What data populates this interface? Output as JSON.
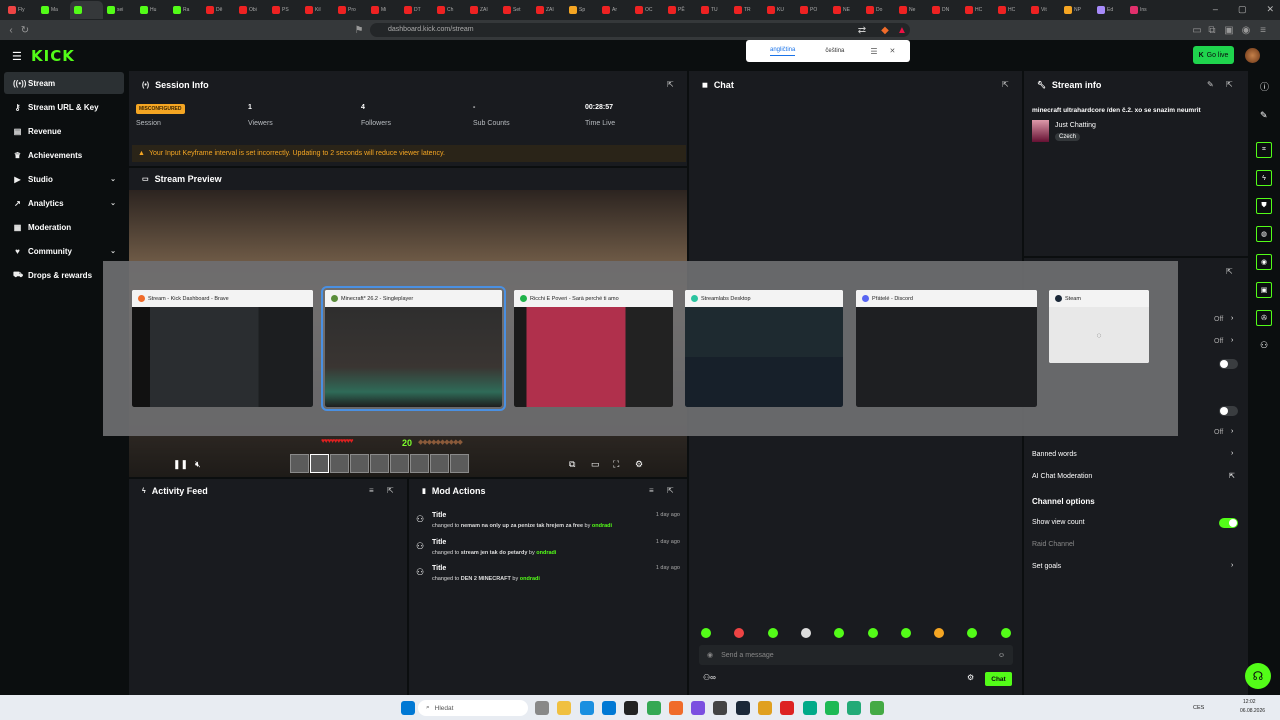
{
  "browser": {
    "url": "dashboard.kick.com/stream",
    "tab_labels": [
      "Fly",
      "Ma",
      "",
      "sei",
      "Hu",
      "Ra",
      "Dĕ",
      "Obi",
      "PS",
      "Kil",
      "Pro",
      "Mi",
      "DT",
      "Ch",
      "ZAI",
      "Set",
      "ZAI",
      "Sp",
      "Ar",
      "OC",
      "PĚ",
      "TU",
      "TR",
      "KU",
      "PO",
      "NE",
      "Do",
      "Ne",
      "DN",
      "HC",
      "HC",
      "Vit",
      "NP",
      "Ed",
      "Ins"
    ]
  },
  "translate": {
    "lang1": "angličtina",
    "lang2": "čeština"
  },
  "header": {
    "logo": "KICK",
    "go_live": "Go live"
  },
  "sidebar": {
    "items": [
      {
        "label": "Stream",
        "icon": "broadcast-icon"
      },
      {
        "label": "Stream URL & Key",
        "icon": "key-icon"
      },
      {
        "label": "Revenue",
        "icon": "revenue-icon"
      },
      {
        "label": "Achievements",
        "icon": "trophy-icon"
      },
      {
        "label": "Studio",
        "icon": "studio-icon"
      },
      {
        "label": "Analytics",
        "icon": "analytics-icon"
      },
      {
        "label": "Moderation",
        "icon": "moderation-icon"
      },
      {
        "label": "Community",
        "icon": "community-icon"
      },
      {
        "label": "Drops & rewards",
        "icon": "gift-icon"
      }
    ]
  },
  "session": {
    "title": "Session Info",
    "status": "MISCONFIGURED",
    "status_label": "Session",
    "viewers": "1",
    "viewers_label": "Viewers",
    "followers": "4",
    "followers_label": "Followers",
    "subs": "-",
    "subs_label": "Sub Counts",
    "time_live": "00:28:57",
    "time_label": "Time Live",
    "warning": "Your Input Keyframe interval is set incorrectly. Updating to 2 seconds will reduce viewer latency."
  },
  "preview": {
    "title": "Stream Preview",
    "xp_level": "20"
  },
  "alt_tab": {
    "windows": [
      {
        "title": "Stream - Kick Dashboard - Brave"
      },
      {
        "title": "Minecraft* 26.2 - Singleplayer"
      },
      {
        "title": "Ricchi E Poveri - Sarà perché ti amo"
      },
      {
        "title": "Streamlabs Desktop"
      },
      {
        "title": "Přátelé - Discord"
      },
      {
        "title": "Steam"
      }
    ]
  },
  "chat": {
    "title": "Chat",
    "placeholder": "Send a message",
    "send": "Chat"
  },
  "stream_info": {
    "title": "Stream info",
    "stream_title": "minecraft ultrahardcore /den č.2. xo se snazim neumrit",
    "category": "Just Chatting",
    "language": "Czech",
    "off1": "Off",
    "off2": "Off",
    "off3": "Off",
    "banned_words": "Banned words",
    "ai_moderation": "AI Chat Moderation",
    "channel_options": "Channel options",
    "show_view_count": "Show view count",
    "raid_channel": "Raid Channel",
    "set_goals": "Set goals"
  },
  "activity": {
    "title": "Activity Feed"
  },
  "mod_actions": {
    "title": "Mod Actions",
    "items": [
      {
        "title": "Title",
        "prefix": "changed to",
        "value": "nemam na only up za penize tak hrejem za free",
        "by_word": "by",
        "by": "ondradi",
        "ago": "1 day ago"
      },
      {
        "title": "Title",
        "prefix": "changed to",
        "value": "stream jen tak do petardy",
        "by_word": "by",
        "by": "ondradi",
        "ago": "1 day ago"
      },
      {
        "title": "Title",
        "prefix": "changed to",
        "value": "DEN 2 MINECRAFT",
        "by_word": "by",
        "by": "ondradi",
        "ago": "1 day ago"
      }
    ]
  },
  "taskbar": {
    "search": "Hledat",
    "lang": "CES",
    "time": "12:02",
    "date": "06.08.2026"
  }
}
